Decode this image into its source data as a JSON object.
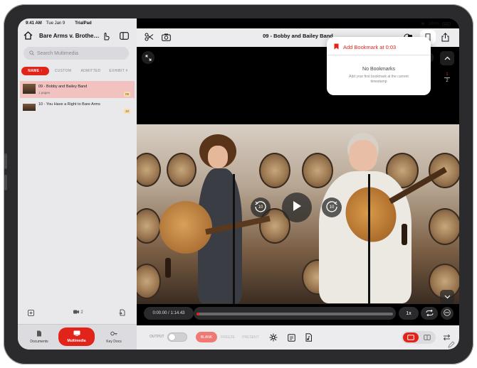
{
  "status_bar": {
    "time": "9:41 AM",
    "date": "Tue Jan 9",
    "app": "TrialPad",
    "battery": "100%"
  },
  "sidebar": {
    "case_title": "Bare Arms v. Brothe…",
    "search_placeholder": "Search Multimedia",
    "sort_tabs": [
      "NAME ↑",
      "CUSTOM",
      "ADMITTED",
      "EXHIBIT #"
    ],
    "files": [
      {
        "title": "09 - Bobby and Bailey Band",
        "subtitle": "1 pages",
        "badge": "09",
        "selected": true
      },
      {
        "title": "10 - You Have a Right to Bare Arms",
        "subtitle": "",
        "badge": "10",
        "selected": false
      }
    ],
    "video_count": "2",
    "tabs": [
      {
        "label": "Documents",
        "icon": "document-icon"
      },
      {
        "label": "Multimedia",
        "icon": "tv-icon"
      },
      {
        "label": "Key Docs",
        "icon": "key-docs-icon"
      }
    ]
  },
  "main": {
    "title": "09 - Bobby and Bailey Band",
    "skip_back": "10",
    "skip_forward": "10",
    "page_indicator": {
      "current": "1",
      "total": "2"
    },
    "time": "0:00.00 / 1:14.43",
    "progress": 0.01,
    "speed": "1x"
  },
  "bookmark_popover": {
    "add_label": "Add Bookmark at 0:03",
    "empty_title": "No Bookmarks",
    "empty_sub": "Add your first bookmark at the current timestamp"
  },
  "bottom_bar": {
    "output_label": "OUTPUT",
    "modes": [
      "BLANK",
      "FREEZE",
      "PRESENT"
    ]
  },
  "colors": {
    "accent": "#e2231a",
    "selected_row": "#f2c2c0",
    "badge": "#f6dfa8"
  }
}
